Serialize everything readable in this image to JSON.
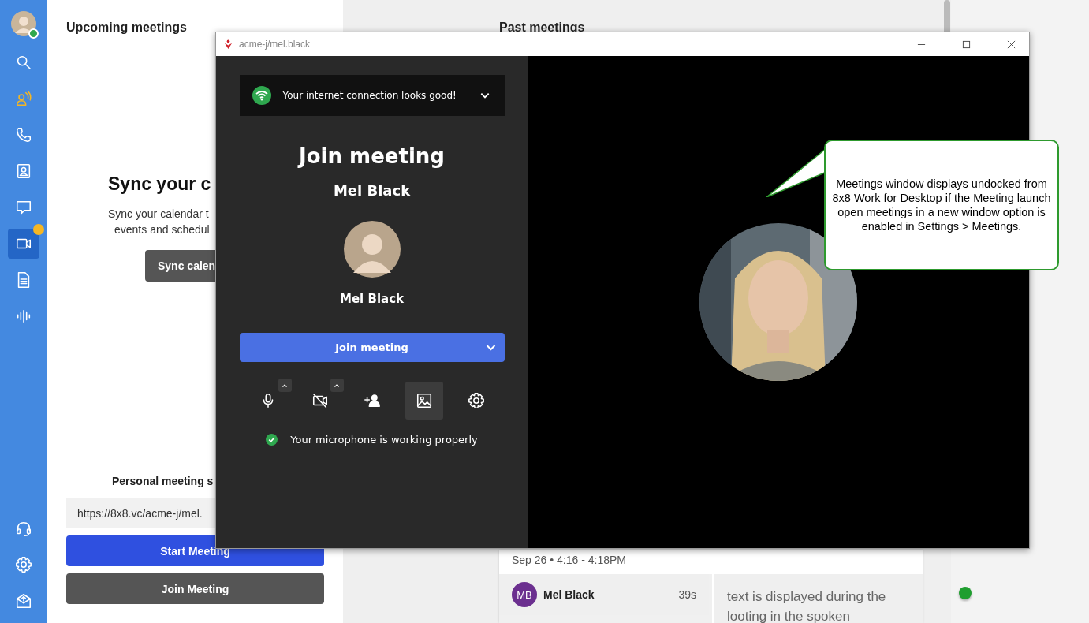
{
  "sidebar": {
    "avatar": {
      "online": true
    },
    "items": [
      {
        "kind": "search",
        "selected": false,
        "alert": false,
        "badge": false
      },
      {
        "kind": "activity",
        "selected": false,
        "alert": true,
        "badge": false
      },
      {
        "kind": "phone",
        "selected": false,
        "alert": false,
        "badge": false
      },
      {
        "kind": "contacts",
        "selected": false,
        "alert": false,
        "badge": false
      },
      {
        "kind": "chat",
        "selected": false,
        "alert": false,
        "badge": false
      },
      {
        "kind": "video",
        "selected": true,
        "alert": false,
        "badge": true
      },
      {
        "kind": "document",
        "selected": false,
        "alert": false,
        "badge": false
      },
      {
        "kind": "voice",
        "selected": false,
        "alert": false,
        "badge": false
      }
    ],
    "bottom_items": [
      {
        "kind": "headset"
      },
      {
        "kind": "settings"
      },
      {
        "kind": "inbox"
      }
    ]
  },
  "upcoming": {
    "title": "Upcoming meetings",
    "sync_heading": "Sync your c",
    "sync_text": [
      "Sync your calendar t",
      "events and schedul"
    ],
    "sync_button": "Sync calen",
    "personal_label": "Personal meeting s",
    "link_value": "https://8x8.vc/acme-j/mel.",
    "start_button": "Start Meeting",
    "join_button": "Join Meeting"
  },
  "past": {
    "title": "Past meetings",
    "date": "Sep 26 • 4:16 - 4:18PM",
    "participant": {
      "initials": "MB",
      "name": "Mel Black",
      "duration": "39s",
      "color": "#6b2f8f"
    },
    "transcript": "text is displayed during the looting in the spoken",
    "status_online": true
  },
  "meeting_window": {
    "title": "acme-j/mel.black",
    "banner": "Your internet connection looks good!",
    "heading": "Join meeting",
    "name": "Mel Black",
    "avatar_name": "Mel Black",
    "join_button": "Join meeting",
    "toolbar": [
      {
        "kind": "mic",
        "selected": false,
        "options": true
      },
      {
        "kind": "camera-off",
        "selected": false,
        "options": true
      },
      {
        "kind": "invite",
        "selected": false,
        "options": false
      },
      {
        "kind": "background",
        "selected": true,
        "options": false
      },
      {
        "kind": "settings",
        "selected": false,
        "options": false
      }
    ],
    "mic_status": "Your microphone is working properly"
  },
  "callout": {
    "text": "Meetings window displays undocked from 8x8 Work for Desktop if the Meeting launch open meetings in a new window option is enabled in Settings > Meetings."
  }
}
